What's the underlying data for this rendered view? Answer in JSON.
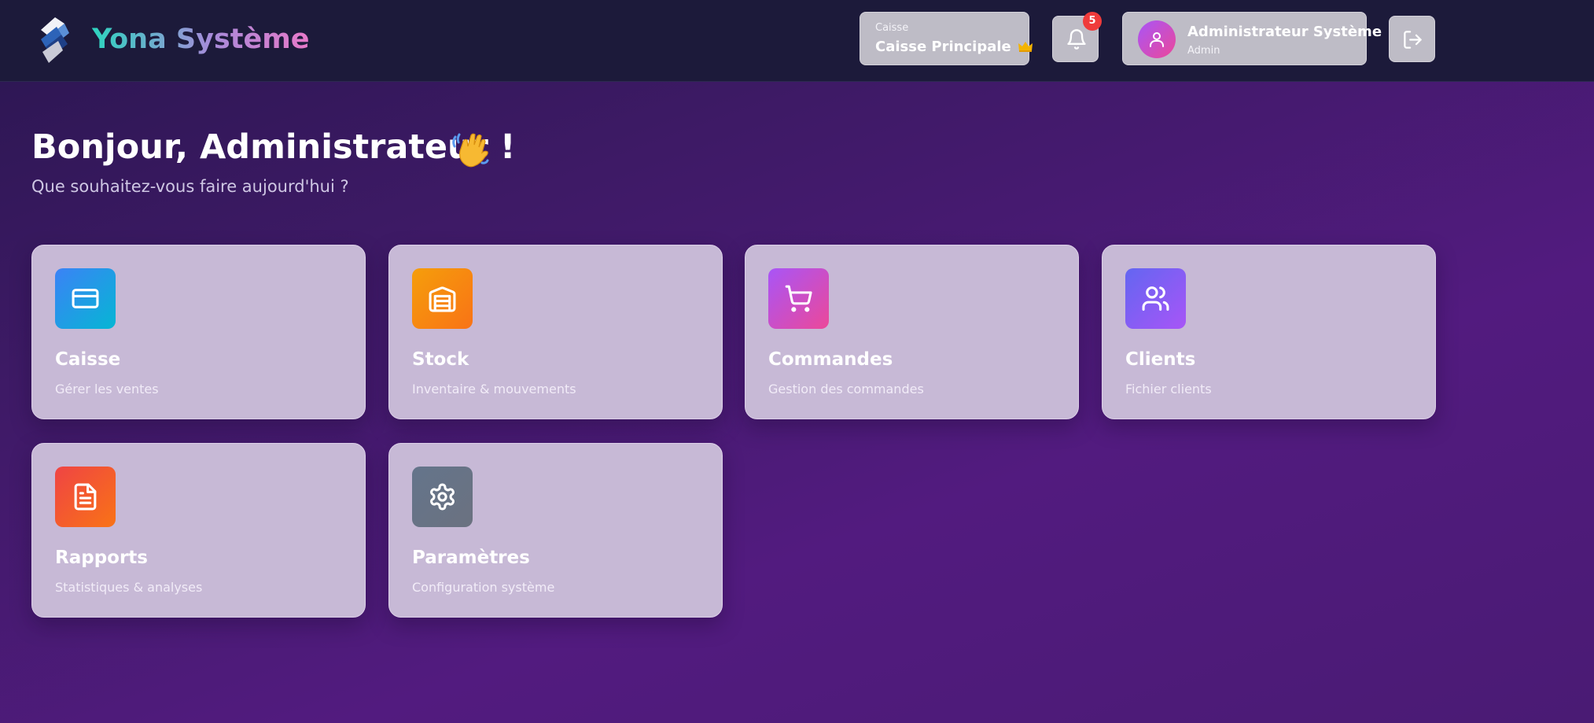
{
  "header": {
    "app_name": "Yona Système",
    "caisse_label": "Caisse",
    "caisse_name": "Caisse Principale",
    "notification_count": "5",
    "user_name": "Administrateur Système",
    "user_role": "Admin",
    "accent_colors": [
      "#2dd4bf",
      "#a78bda",
      "#e879c9"
    ]
  },
  "main": {
    "greeting": "Bonjour, Administrateur !",
    "subtitle": "Que souhaitez-vous faire aujourd'hui ?",
    "cards": [
      {
        "title": "Caisse",
        "description": "Gérer les ventes",
        "icon": "credit-card-icon",
        "color": "#3b82f6"
      },
      {
        "title": "Stock",
        "description": "Inventaire & mouvements",
        "icon": "warehouse-icon",
        "color": "#f59e0b"
      },
      {
        "title": "Commandes",
        "description": "Gestion des commandes",
        "icon": "shopping-cart-icon",
        "color": "#c04fd8"
      },
      {
        "title": "Clients",
        "description": "Fichier clients",
        "icon": "users-icon",
        "color": "#8b5cf6"
      },
      {
        "title": "Rapports",
        "description": "Statistiques & analyses",
        "icon": "file-text-icon",
        "color": "#ef4444"
      },
      {
        "title": "Paramètres",
        "description": "Configuration système",
        "icon": "settings-icon",
        "color": "#64748b"
      }
    ]
  }
}
